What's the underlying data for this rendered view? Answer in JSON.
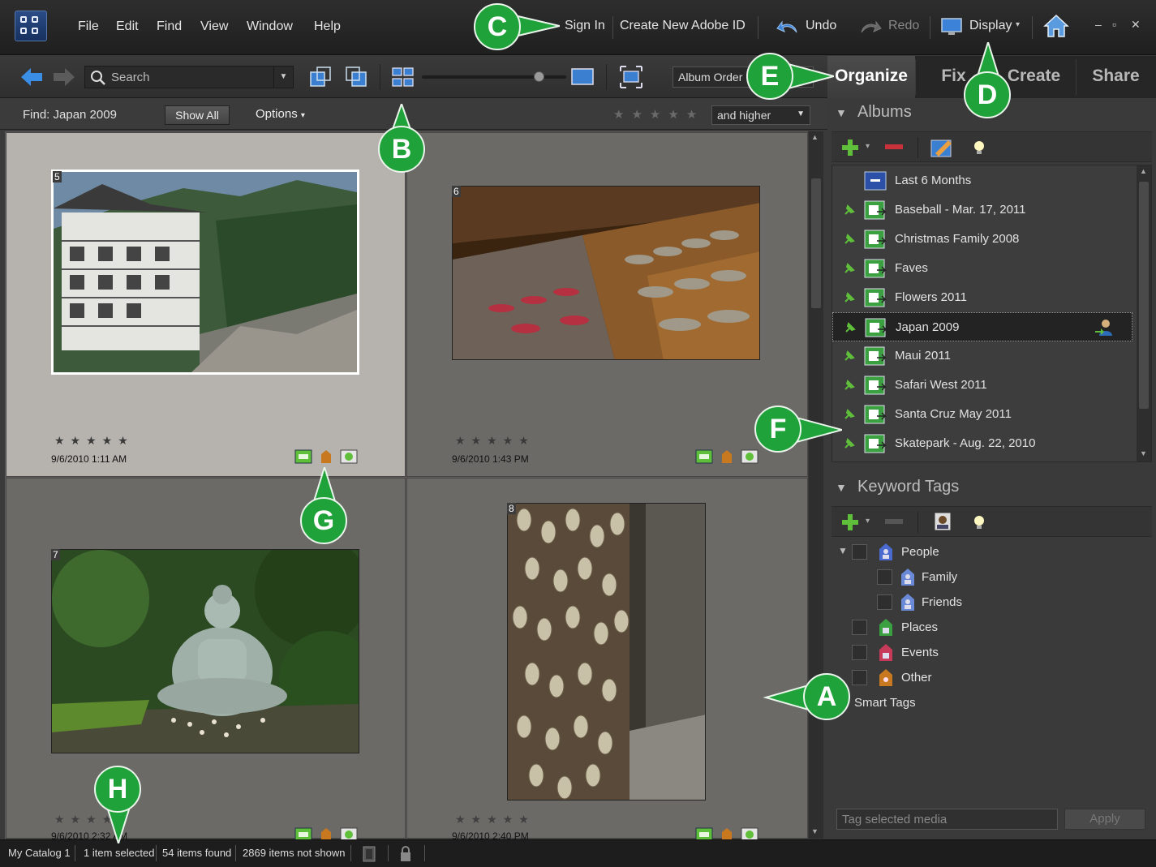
{
  "menubar": {
    "items": [
      "File",
      "Edit",
      "Find",
      "View",
      "Window",
      "Help"
    ],
    "sign_in": "Sign In",
    "create_id": "Create New Adobe ID",
    "undo": "Undo",
    "redo": "Redo",
    "display": "Display",
    "window_controls": [
      "–",
      "▫",
      "✕"
    ]
  },
  "toolbar": {
    "search_placeholder": "Search",
    "sort_order": "Album Order"
  },
  "tabs": [
    "Organize",
    "Fix",
    "Create",
    "Share"
  ],
  "findbar": {
    "label": "Find: Japan 2009",
    "show_all": "Show All",
    "options": "Options",
    "rating_filter": "and higher"
  },
  "media": [
    {
      "num": "5",
      "date": "9/6/2010 1:11 AM",
      "stars": "★★★★★"
    },
    {
      "num": "6",
      "date": "9/6/2010 1:43 PM",
      "stars": "★★★★★"
    },
    {
      "num": "7",
      "date": "9/6/2010 2:32 AM",
      "stars": "★★★★★"
    },
    {
      "num": "8",
      "date": "9/6/2010 2:40 PM",
      "stars": "★★★★★"
    }
  ],
  "albums": {
    "title": "Albums",
    "items": [
      "Last 6 Months",
      "Baseball - Mar. 17, 2011",
      "Christmas Family 2008",
      "Faves",
      "Flowers 2011",
      "Japan 2009",
      "Maui 2011",
      "Safari West 2011",
      "Santa Cruz May 2011",
      "Skatepark - Aug. 22, 2010"
    ]
  },
  "keywords": {
    "title": "Keyword Tags",
    "items": [
      "People",
      "Family",
      "Friends",
      "Places",
      "Events",
      "Other",
      "Smart Tags"
    ],
    "tag_placeholder": "Tag selected media",
    "apply": "Apply"
  },
  "status": {
    "catalog": "My Catalog 1",
    "selected": "1 item selected",
    "found": "54 items found",
    "not_shown": "2869 items not shown"
  },
  "callouts": [
    "A",
    "B",
    "C",
    "D",
    "E",
    "F",
    "G",
    "H"
  ],
  "colors": {
    "callout": "#1fa23a",
    "accent_green": "#5fbf3a"
  }
}
